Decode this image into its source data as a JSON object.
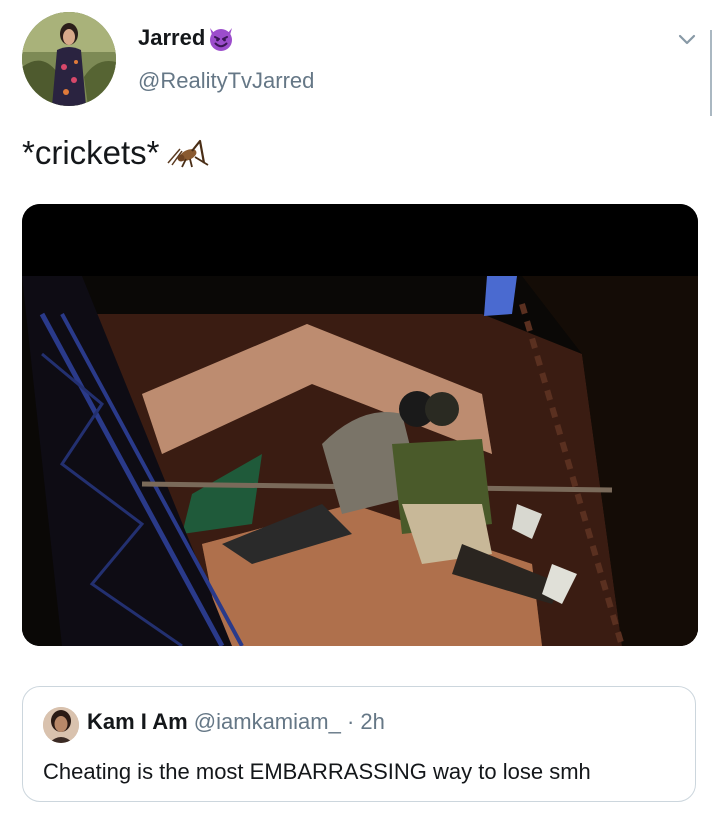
{
  "tweet": {
    "author_name": "Jarred",
    "author_emoji": "smiling-devil-emoji",
    "author_handle": "@RealityTvJarred",
    "text": "*crickets*",
    "text_emoji": "cricket-emoji"
  },
  "quoted_tweet": {
    "author_name": "Kam I Am",
    "author_handle": "@iamkamiam_",
    "separator": "·",
    "time": "2h",
    "text": "Cheating is the most EMBARRASSING way to lose smh"
  },
  "colors": {
    "text_primary": "#14171a",
    "text_secondary": "#657786",
    "border": "#ccd6dd",
    "devil_purple": "#9c4dcc"
  },
  "icons": [
    "chevron-down-icon",
    "smiling-devil-emoji",
    "cricket-emoji"
  ]
}
